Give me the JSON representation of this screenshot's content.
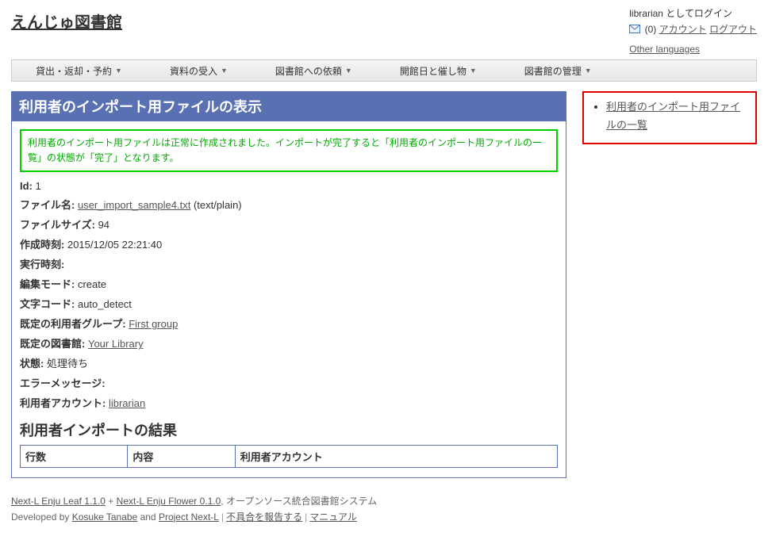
{
  "header": {
    "site_title": "えんじゅ図書館",
    "login_status": "librarian としてログイン",
    "message_count": "(0)",
    "account_link": "アカウント",
    "logout_link": "ログアウト",
    "other_languages": "Other languages"
  },
  "menu": {
    "items": [
      "貸出・返却・予約",
      "資料の受入",
      "図書館への依頼",
      "開館日と催し物",
      "図書館の管理"
    ]
  },
  "page": {
    "title": "利用者のインポート用ファイルの表示",
    "flash": "利用者のインポート用ファイルは正常に作成されました。インポートが完了すると「利用者のインポート用ファイルの一覧」の状態が「完了」となります。"
  },
  "fields": {
    "id_label": "Id:",
    "id_value": "1",
    "filename_label": "ファイル名:",
    "filename_link": "user_import_sample4.txt",
    "filename_mime": "(text/plain)",
    "filesize_label": "ファイルサイズ:",
    "filesize_value": "94",
    "created_label": "作成時刻:",
    "created_value": "2015/12/05 22:21:40",
    "executed_label": "実行時刻:",
    "executed_value": "",
    "mode_label": "編集モード:",
    "mode_value": "create",
    "encoding_label": "文字コード:",
    "encoding_value": "auto_detect",
    "group_label": "既定の利用者グループ:",
    "group_link": "First group",
    "library_label": "既定の図書館:",
    "library_link": "Your Library",
    "state_label": "状態:",
    "state_value": "処理待ち",
    "error_label": "エラーメッセージ:",
    "error_value": "",
    "account_label": "利用者アカウント:",
    "account_link": "librarian"
  },
  "result": {
    "heading": "利用者インポートの結果",
    "col_lines": "行数",
    "col_body": "内容",
    "col_account": "利用者アカウント"
  },
  "sidebar": {
    "link1": "利用者のインポート用ファイルの一覧"
  },
  "footer": {
    "app1": "Next-L Enju Leaf 1.1.0",
    "plus": " + ",
    "app2": "Next-L Enju Flower 0.1.0",
    "tagline": ", オープンソース統合図書館システム",
    "dev_prefix": "Developed by ",
    "dev1": "Kosuke Tanabe",
    "and": " and ",
    "dev2": "Project Next-L",
    "bug": "不具合を報告する",
    "manual": "マニュアル"
  }
}
